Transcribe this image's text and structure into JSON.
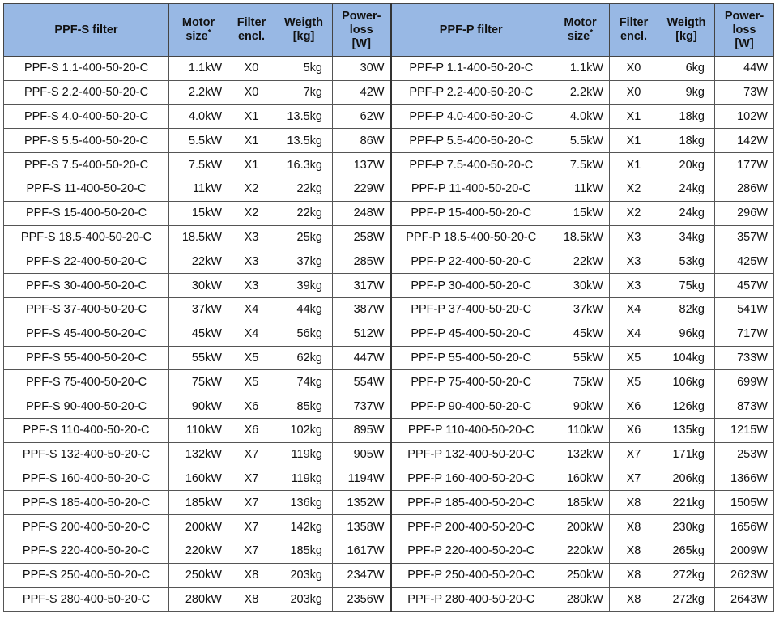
{
  "headers": {
    "s_filter": "PPF-S filter",
    "motor_line1": "Motor",
    "motor_line2": "size",
    "motor_mark": "*",
    "encl_line1": "Filter",
    "encl_line2": "encl.",
    "weight_line1": "Weigth",
    "weight_line2": "[kg]",
    "loss_line1": "Power-",
    "loss_line2": "loss",
    "loss_line3": "[W]",
    "p_filter": "PPF-P filter"
  },
  "rows": [
    {
      "s_name": "PPF-S 1.1-400-50-20-C",
      "s_motor": "1.1kW",
      "s_encl": "X0",
      "s_weight": "5kg",
      "s_loss": "30W",
      "p_name": "PPF-P 1.1-400-50-20-C",
      "p_motor": "1.1kW",
      "p_encl": "X0",
      "p_weight": "6kg",
      "p_loss": "44W"
    },
    {
      "s_name": "PPF-S 2.2-400-50-20-C",
      "s_motor": "2.2kW",
      "s_encl": "X0",
      "s_weight": "7kg",
      "s_loss": "42W",
      "p_name": "PPF-P 2.2-400-50-20-C",
      "p_motor": "2.2kW",
      "p_encl": "X0",
      "p_weight": "9kg",
      "p_loss": "73W"
    },
    {
      "s_name": "PPF-S 4.0-400-50-20-C",
      "s_motor": "4.0kW",
      "s_encl": "X1",
      "s_weight": "13.5kg",
      "s_loss": "62W",
      "p_name": "PPF-P 4.0-400-50-20-C",
      "p_motor": "4.0kW",
      "p_encl": "X1",
      "p_weight": "18kg",
      "p_loss": "102W"
    },
    {
      "s_name": "PPF-S 5.5-400-50-20-C",
      "s_motor": "5.5kW",
      "s_encl": "X1",
      "s_weight": "13.5kg",
      "s_loss": "86W",
      "p_name": "PPF-P 5.5-400-50-20-C",
      "p_motor": "5.5kW",
      "p_encl": "X1",
      "p_weight": "18kg",
      "p_loss": "142W"
    },
    {
      "s_name": "PPF-S 7.5-400-50-20-C",
      "s_motor": "7.5kW",
      "s_encl": "X1",
      "s_weight": "16.3kg",
      "s_loss": "137W",
      "p_name": "PPF-P 7.5-400-50-20-C",
      "p_motor": "7.5kW",
      "p_encl": "X1",
      "p_weight": "20kg",
      "p_loss": "177W"
    },
    {
      "s_name": "PPF-S 11-400-50-20-C",
      "s_motor": "11kW",
      "s_encl": "X2",
      "s_weight": "22kg",
      "s_loss": "229W",
      "p_name": "PPF-P 11-400-50-20-C",
      "p_motor": "11kW",
      "p_encl": "X2",
      "p_weight": "24kg",
      "p_loss": "286W"
    },
    {
      "s_name": "PPF-S 15-400-50-20-C",
      "s_motor": "15kW",
      "s_encl": "X2",
      "s_weight": "22kg",
      "s_loss": "248W",
      "p_name": "PPF-P 15-400-50-20-C",
      "p_motor": "15kW",
      "p_encl": "X2",
      "p_weight": "24kg",
      "p_loss": "296W"
    },
    {
      "s_name": "PPF-S 18.5-400-50-20-C",
      "s_motor": "18.5kW",
      "s_encl": "X3",
      "s_weight": "25kg",
      "s_loss": "258W",
      "p_name": "PPF-P 18.5-400-50-20-C",
      "p_motor": "18.5kW",
      "p_encl": "X3",
      "p_weight": "34kg",
      "p_loss": "357W"
    },
    {
      "s_name": "PPF-S 22-400-50-20-C",
      "s_motor": "22kW",
      "s_encl": "X3",
      "s_weight": "37kg",
      "s_loss": "285W",
      "p_name": "PPF-P 22-400-50-20-C",
      "p_motor": "22kW",
      "p_encl": "X3",
      "p_weight": "53kg",
      "p_loss": "425W"
    },
    {
      "s_name": "PPF-S 30-400-50-20-C",
      "s_motor": "30kW",
      "s_encl": "X3",
      "s_weight": "39kg",
      "s_loss": "317W",
      "p_name": "PPF-P 30-400-50-20-C",
      "p_motor": "30kW",
      "p_encl": "X3",
      "p_weight": "75kg",
      "p_loss": "457W"
    },
    {
      "s_name": "PPF-S 37-400-50-20-C",
      "s_motor": "37kW",
      "s_encl": "X4",
      "s_weight": "44kg",
      "s_loss": "387W",
      "p_name": "PPF-P 37-400-50-20-C",
      "p_motor": "37kW",
      "p_encl": "X4",
      "p_weight": "82kg",
      "p_loss": "541W"
    },
    {
      "s_name": "PPF-S 45-400-50-20-C",
      "s_motor": "45kW",
      "s_encl": "X4",
      "s_weight": "56kg",
      "s_loss": "512W",
      "p_name": "PPF-P 45-400-50-20-C",
      "p_motor": "45kW",
      "p_encl": "X4",
      "p_weight": "96kg",
      "p_loss": "717W"
    },
    {
      "s_name": "PPF-S 55-400-50-20-C",
      "s_motor": "55kW",
      "s_encl": "X5",
      "s_weight": "62kg",
      "s_loss": "447W",
      "p_name": "PPF-P 55-400-50-20-C",
      "p_motor": "55kW",
      "p_encl": "X5",
      "p_weight": "104kg",
      "p_loss": "733W"
    },
    {
      "s_name": "PPF-S 75-400-50-20-C",
      "s_motor": "75kW",
      "s_encl": "X5",
      "s_weight": "74kg",
      "s_loss": "554W",
      "p_name": "PPF-P 75-400-50-20-C",
      "p_motor": "75kW",
      "p_encl": "X5",
      "p_weight": "106kg",
      "p_loss": "699W"
    },
    {
      "s_name": "PPF-S 90-400-50-20-C",
      "s_motor": "90kW",
      "s_encl": "X6",
      "s_weight": "85kg",
      "s_loss": "737W",
      "p_name": "PPF-P 90-400-50-20-C",
      "p_motor": "90kW",
      "p_encl": "X6",
      "p_weight": "126kg",
      "p_loss": "873W"
    },
    {
      "s_name": "PPF-S 110-400-50-20-C",
      "s_motor": "110kW",
      "s_encl": "X6",
      "s_weight": "102kg",
      "s_loss": "895W",
      "p_name": "PPF-P 110-400-50-20-C",
      "p_motor": "110kW",
      "p_encl": "X6",
      "p_weight": "135kg",
      "p_loss": "1215W"
    },
    {
      "s_name": "PPF-S 132-400-50-20-C",
      "s_motor": "132kW",
      "s_encl": "X7",
      "s_weight": "119kg",
      "s_loss": "905W",
      "p_name": "PPF-P 132-400-50-20-C",
      "p_motor": "132kW",
      "p_encl": "X7",
      "p_weight": "171kg",
      "p_loss": "253W"
    },
    {
      "s_name": "PPF-S 160-400-50-20-C",
      "s_motor": "160kW",
      "s_encl": "X7",
      "s_weight": "119kg",
      "s_loss": "1194W",
      "p_name": "PPF-P 160-400-50-20-C",
      "p_motor": "160kW",
      "p_encl": "X7",
      "p_weight": "206kg",
      "p_loss": "1366W"
    },
    {
      "s_name": "PPF-S 185-400-50-20-C",
      "s_motor": "185kW",
      "s_encl": "X7",
      "s_weight": "136kg",
      "s_loss": "1352W",
      "p_name": "PPF-P 185-400-50-20-C",
      "p_motor": "185kW",
      "p_encl": "X8",
      "p_weight": "221kg",
      "p_loss": "1505W"
    },
    {
      "s_name": "PPF-S 200-400-50-20-C",
      "s_motor": "200kW",
      "s_encl": "X7",
      "s_weight": "142kg",
      "s_loss": "1358W",
      "p_name": "PPF-P 200-400-50-20-C",
      "p_motor": "200kW",
      "p_encl": "X8",
      "p_weight": "230kg",
      "p_loss": "1656W"
    },
    {
      "s_name": "PPF-S 220-400-50-20-C",
      "s_motor": "220kW",
      "s_encl": "X7",
      "s_weight": "185kg",
      "s_loss": "1617W",
      "p_name": "PPF-P 220-400-50-20-C",
      "p_motor": "220kW",
      "p_encl": "X8",
      "p_weight": "265kg",
      "p_loss": "2009W"
    },
    {
      "s_name": "PPF-S 250-400-50-20-C",
      "s_motor": "250kW",
      "s_encl": "X8",
      "s_weight": "203kg",
      "s_loss": "2347W",
      "p_name": "PPF-P 250-400-50-20-C",
      "p_motor": "250kW",
      "p_encl": "X8",
      "p_weight": "272kg",
      "p_loss": "2623W"
    },
    {
      "s_name": "PPF-S 280-400-50-20-C",
      "s_motor": "280kW",
      "s_encl": "X8",
      "s_weight": "203kg",
      "s_loss": "2356W",
      "p_name": "PPF-P 280-400-50-20-C",
      "p_motor": "280kW",
      "p_encl": "X8",
      "p_weight": "272kg",
      "p_loss": "2643W"
    }
  ]
}
